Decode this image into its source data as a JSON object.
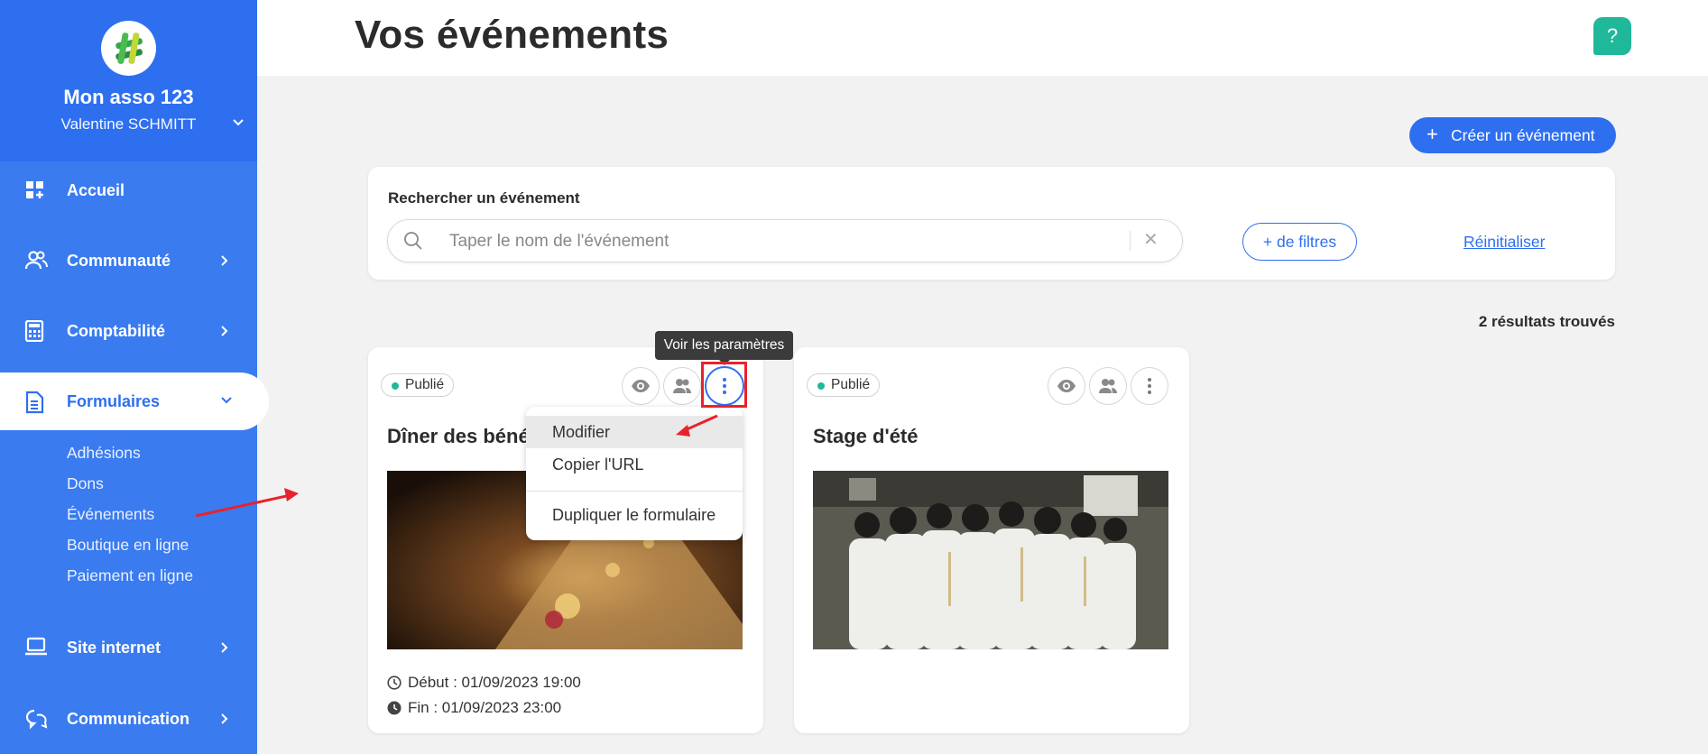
{
  "sidebar": {
    "org_name": "Mon asso 123",
    "user_name": "Valentine SCHMITT",
    "items": [
      {
        "label": "Accueil",
        "icon": "dashboard-icon"
      },
      {
        "label": "Communauté",
        "icon": "community-icon"
      },
      {
        "label": "Comptabilité",
        "icon": "calculator-icon"
      },
      {
        "label": "Formulaires",
        "icon": "document-icon",
        "active": true
      },
      {
        "label": "Site internet",
        "icon": "laptop-icon"
      },
      {
        "label": "Communication",
        "icon": "chat-icon"
      }
    ],
    "sub_items": [
      "Adhésions",
      "Dons",
      "Événements",
      "Boutique en ligne",
      "Paiement en ligne"
    ]
  },
  "header": {
    "title": "Vos événements",
    "help": "?"
  },
  "toolbar": {
    "create_label": "Créer un événement"
  },
  "search": {
    "label": "Rechercher un événement",
    "placeholder": "Taper le nom de l'événement",
    "value": "",
    "clear": "✕",
    "filters_label": "+ de filtres",
    "reset_label": "Réinitialiser"
  },
  "results": "2 résultats trouvés",
  "events": [
    {
      "status": "Publié",
      "title": "Dîner des béné",
      "start": "Début : 01/09/2023 19:00",
      "end": "Fin : 01/09/2023 23:00"
    },
    {
      "status": "Publié",
      "title": "Stage d'été"
    }
  ],
  "tooltip": "Voir les paramètres",
  "menu": {
    "items": [
      "Modifier",
      "Copier l'URL",
      "Dupliquer le formulaire"
    ]
  },
  "colors": {
    "brand": "#2e6ff0",
    "sidebar": "#3a7bf0",
    "published": "#1fb89a",
    "annotation": "#e8222b"
  }
}
